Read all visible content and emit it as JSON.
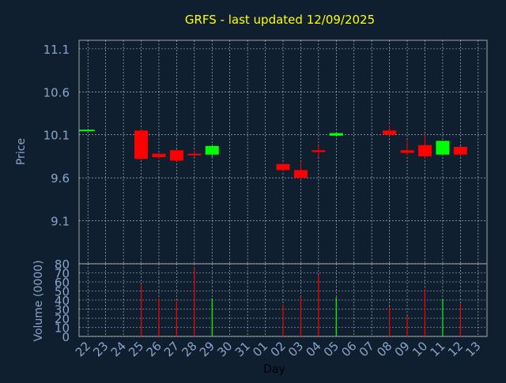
{
  "chart_data": {
    "type": "candlestick",
    "title": "GRFS - last updated 12/09/2025",
    "xlabel": "Day",
    "colors": {
      "background": "#0f1f30",
      "title": "#ffff00",
      "axis_text": "#8aa4c8",
      "xlabel": "#000000",
      "grid": "#ffffff",
      "up": "#00ff00",
      "down": "#ff0000"
    },
    "days": [
      "22",
      "23",
      "24",
      "25",
      "26",
      "27",
      "28",
      "29",
      "30",
      "31",
      "01",
      "02",
      "03",
      "04",
      "05",
      "06",
      "07",
      "08",
      "09",
      "10",
      "11",
      "12",
      "13"
    ],
    "price_panel": {
      "ylabel": "Price",
      "ylim": [
        8.6,
        11.2
      ],
      "ticks": [
        9.1,
        9.6,
        10.1,
        10.6,
        11.1
      ],
      "tick_labels": [
        "9.1",
        "9.6",
        "10.1",
        "10.6",
        "11.1"
      ],
      "candles": [
        {
          "day": "22",
          "open": 10.15,
          "high": 10.16,
          "low": 10.14,
          "close": 10.16
        },
        {
          "day": "25",
          "open": 10.15,
          "high": 10.17,
          "low": 9.81,
          "close": 9.82
        },
        {
          "day": "26",
          "open": 9.88,
          "high": 9.89,
          "low": 9.82,
          "close": 9.84
        },
        {
          "day": "27",
          "open": 9.92,
          "high": 9.93,
          "low": 9.79,
          "close": 9.8
        },
        {
          "day": "28",
          "open": 9.88,
          "high": 9.92,
          "low": 9.84,
          "close": 9.87
        },
        {
          "day": "29",
          "open": 9.87,
          "high": 9.97,
          "low": 9.84,
          "close": 9.97
        },
        {
          "day": "02",
          "open": 9.76,
          "high": 9.77,
          "low": 9.68,
          "close": 9.69
        },
        {
          "day": "03",
          "open": 9.69,
          "high": 9.78,
          "low": 9.59,
          "close": 9.6
        },
        {
          "day": "04",
          "open": 9.92,
          "high": 9.98,
          "low": 9.84,
          "close": 9.9
        },
        {
          "day": "05",
          "open": 10.09,
          "high": 10.13,
          "low": 10.08,
          "close": 10.12
        },
        {
          "day": "08",
          "open": 10.15,
          "high": 10.21,
          "low": 10.09,
          "close": 10.1
        },
        {
          "day": "09",
          "open": 9.92,
          "high": 10.04,
          "low": 9.86,
          "close": 9.89
        },
        {
          "day": "10",
          "open": 9.98,
          "high": 10.1,
          "low": 9.82,
          "close": 9.85
        },
        {
          "day": "11",
          "open": 9.87,
          "high": 10.03,
          "low": 9.87,
          "close": 10.03
        },
        {
          "day": "12",
          "open": 9.96,
          "high": 9.97,
          "low": 9.85,
          "close": 9.87
        }
      ]
    },
    "volume_panel": {
      "ylabel": "Volume (0000)",
      "ylim": [
        0,
        80
      ],
      "ticks": [
        0,
        10,
        20,
        30,
        40,
        50,
        60,
        70,
        80
      ],
      "tick_labels": [
        "0",
        "10",
        "20",
        "30",
        "40",
        "50",
        "60",
        "70",
        "80"
      ],
      "bars": [
        {
          "day": "25",
          "value": 57,
          "dir": "down"
        },
        {
          "day": "26",
          "value": 42,
          "dir": "down"
        },
        {
          "day": "27",
          "value": 39,
          "dir": "down"
        },
        {
          "day": "28",
          "value": 76,
          "dir": "down"
        },
        {
          "day": "29",
          "value": 42,
          "dir": "up"
        },
        {
          "day": "02",
          "value": 35,
          "dir": "down"
        },
        {
          "day": "03",
          "value": 44,
          "dir": "down"
        },
        {
          "day": "04",
          "value": 68,
          "dir": "down"
        },
        {
          "day": "05",
          "value": 43,
          "dir": "up"
        },
        {
          "day": "08",
          "value": 33,
          "dir": "down"
        },
        {
          "day": "09",
          "value": 23,
          "dir": "down"
        },
        {
          "day": "10",
          "value": 52,
          "dir": "down"
        },
        {
          "day": "11",
          "value": 41,
          "dir": "up"
        },
        {
          "day": "12",
          "value": 36,
          "dir": "down"
        }
      ]
    }
  }
}
